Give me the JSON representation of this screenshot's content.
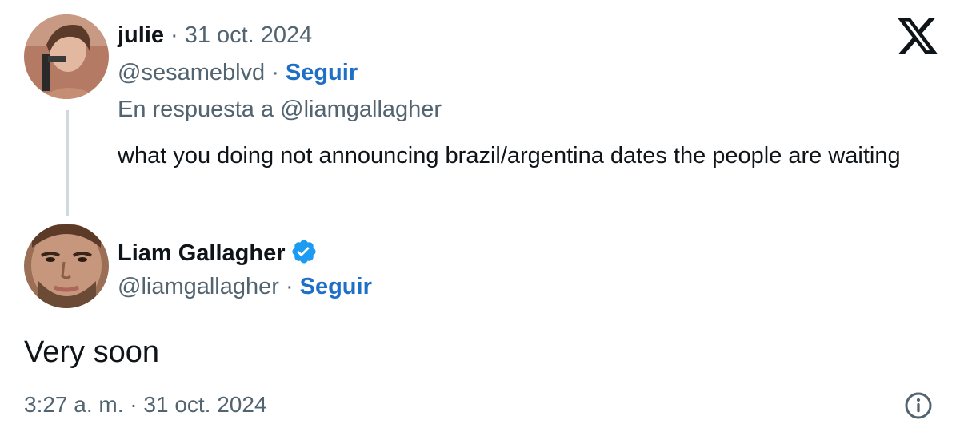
{
  "reply_context": {
    "author_name": "julie",
    "separator": "·",
    "date": "31 oct. 2024",
    "handle": "@sesameblvd",
    "follow_label": "Seguir",
    "in_reply_to": "En respuesta a @liamgallagher",
    "text": "what you doing not announcing brazil/argentina dates the people are waiting"
  },
  "main_tweet": {
    "author_name": "Liam Gallagher",
    "handle": "@liamgallagher",
    "separator": "·",
    "follow_label": "Seguir",
    "text": "Very soon",
    "timestamp": "3:27 a. m. · 31 oct. 2024"
  },
  "icons": {
    "brand": "x-logo-icon",
    "verified": "verified-badge-icon",
    "info": "info-icon"
  },
  "colors": {
    "link": "#1d6fc7",
    "verified": "#1d9bf0",
    "secondary_text": "#536471"
  }
}
